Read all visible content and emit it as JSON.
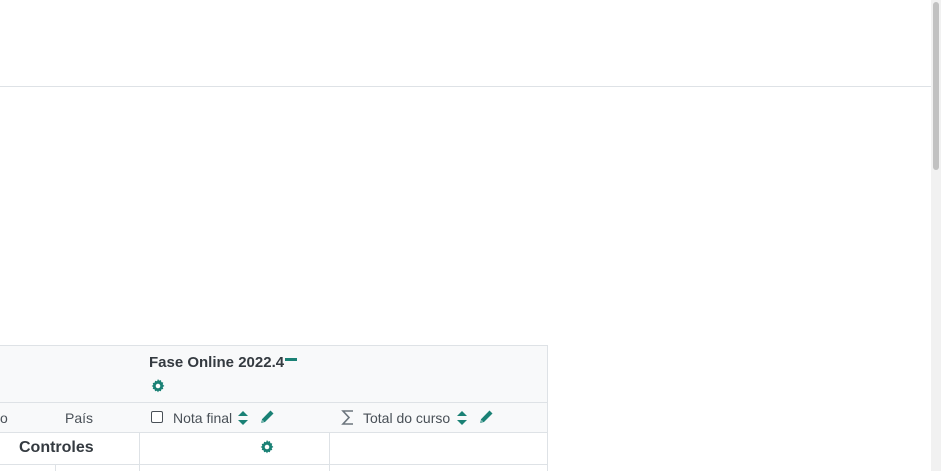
{
  "category": {
    "title": "Fase Online 2022.4"
  },
  "columns": {
    "email_partial": "o",
    "country": "País",
    "final_grade": "Nota final",
    "course_total": "Total do curso"
  },
  "controls_row": {
    "label": "Controles"
  },
  "colors": {
    "accent": "#1a8175",
    "border": "#dee2e6",
    "header_bg": "#f8f9fa"
  },
  "icons": [
    "collapse-icon",
    "gear-icon",
    "checkbox-icon",
    "sort-icon",
    "edit-icon",
    "sigma-icon"
  ]
}
